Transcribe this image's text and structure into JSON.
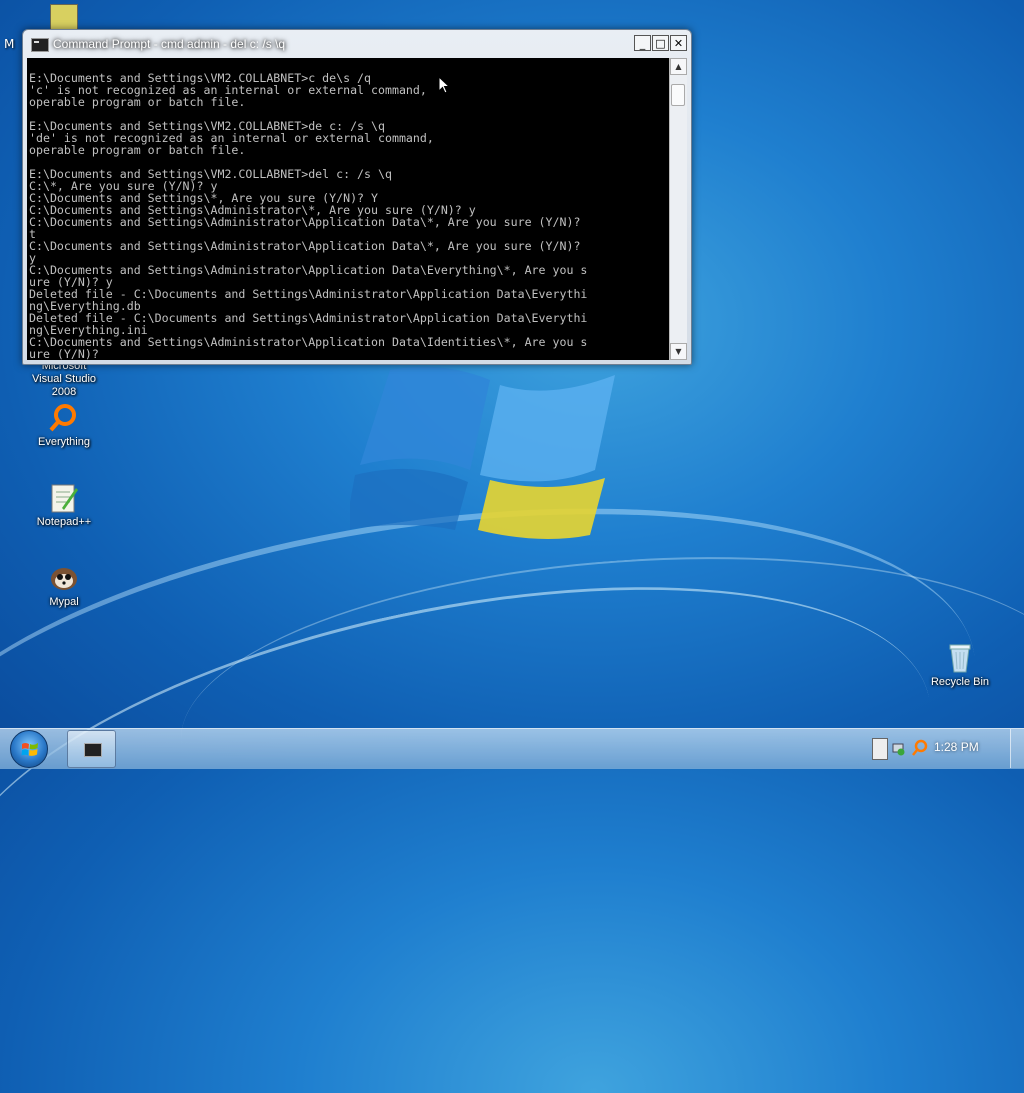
{
  "desktop": {
    "icons": [
      {
        "label": "Microsoft Visual Studio 2008",
        "icon": "visual-studio-icon"
      },
      {
        "label": "Everything",
        "icon": "everything-search-icon"
      },
      {
        "label": "Notepad++",
        "icon": "notepad-plus-plus-icon"
      },
      {
        "label": "Mypal",
        "icon": "mypal-browser-icon"
      },
      {
        "label": "Recycle Bin",
        "icon": "recycle-bin-icon"
      }
    ],
    "partial_label": "M"
  },
  "window": {
    "title": "Command Prompt - cmd admin - del c: /s \\q",
    "minimize": "_",
    "maximize": "□",
    "close": "✕",
    "console_lines": [
      "",
      "E:\\Documents and Settings\\VM2.COLLABNET>c de\\s /q",
      "'c' is not recognized as an internal or external command,",
      "operable program or batch file.",
      "",
      "E:\\Documents and Settings\\VM2.COLLABNET>de c: /s \\q",
      "'de' is not recognized as an internal or external command,",
      "operable program or batch file.",
      "",
      "E:\\Documents and Settings\\VM2.COLLABNET>del c: /s \\q",
      "C:\\*, Are you sure (Y/N)? y",
      "C:\\Documents and Settings\\*, Are you sure (Y/N)? Y",
      "C:\\Documents and Settings\\Administrator\\*, Are you sure (Y/N)? y",
      "C:\\Documents and Settings\\Administrator\\Application Data\\*, Are you sure (Y/N)?",
      "t",
      "C:\\Documents and Settings\\Administrator\\Application Data\\*, Are you sure (Y/N)?",
      "y",
      "C:\\Documents and Settings\\Administrator\\Application Data\\Everything\\*, Are you s",
      "ure (Y/N)? y",
      "Deleted file - C:\\Documents and Settings\\Administrator\\Application Data\\Everythi",
      "ng\\Everything.db",
      "Deleted file - C:\\Documents and Settings\\Administrator\\Application Data\\Everythi",
      "ng\\Everything.ini",
      "C:\\Documents and Settings\\Administrator\\Application Data\\Identities\\*, Are you s",
      "ure (Y/N)?"
    ]
  },
  "taskbar": {
    "clock": "1:28 PM"
  },
  "colors": {
    "console_bg": "#000000",
    "console_fg": "#c0c0c0",
    "desktop_blue": "#1f7fcf"
  }
}
